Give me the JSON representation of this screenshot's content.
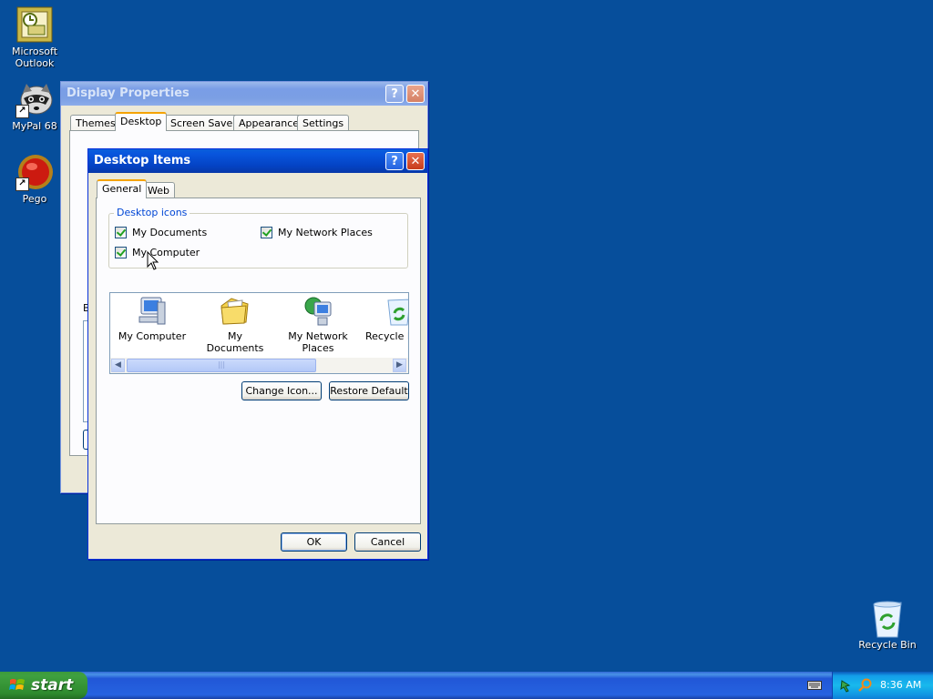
{
  "desktop": {
    "icons": [
      {
        "label_line1": "Microsoft",
        "label_line2": "Outlook",
        "icon": "outlook-icon"
      },
      {
        "label_line1": "MyPal 68",
        "label_line2": "",
        "icon": "mypal-raccoon-icon"
      },
      {
        "label_line1": "Pego",
        "label_line2": "",
        "icon": "pego-red-ball-icon"
      },
      {
        "label_line1": "Recycle Bin",
        "label_line2": "",
        "icon": "recycle-bin-icon"
      }
    ]
  },
  "display_properties": {
    "title": "Display Properties",
    "tabs": [
      "Themes",
      "Desktop",
      "Screen Saver",
      "Appearance",
      "Settings"
    ],
    "active_tab": "Desktop",
    "background_label_fragment": "B"
  },
  "desktop_items": {
    "title": "Desktop Items",
    "tabs": [
      "General",
      "Web"
    ],
    "active_tab": "General",
    "group_title": "Desktop icons",
    "checkboxes": [
      {
        "label": "My Documents",
        "checked": true
      },
      {
        "label": "My Network Places",
        "checked": true
      },
      {
        "label": "My Computer",
        "checked": true
      }
    ],
    "icon_list": [
      {
        "label_line1": "My Computer",
        "label_line2": "",
        "icon": "my-computer-icon"
      },
      {
        "label_line1": "My Documents",
        "label_line2": "",
        "icon": "my-documents-icon"
      },
      {
        "label_line1": "My Network",
        "label_line2": "Places",
        "icon": "my-network-places-icon"
      },
      {
        "label_line1": "Recycle B",
        "label_line2": "",
        "icon": "recycle-bin-icon"
      }
    ],
    "change_icon_label": "Change Icon...",
    "restore_default_label": "Restore Default",
    "ok_label": "OK",
    "cancel_label": "Cancel"
  },
  "taskbar": {
    "start_label": "start",
    "clock": "8:36 AM"
  },
  "colors": {
    "desktop_bg": "#064e9b",
    "title_active": "#0855dd",
    "tab_highlight": "#f5a300",
    "check_green": "#21a121"
  }
}
